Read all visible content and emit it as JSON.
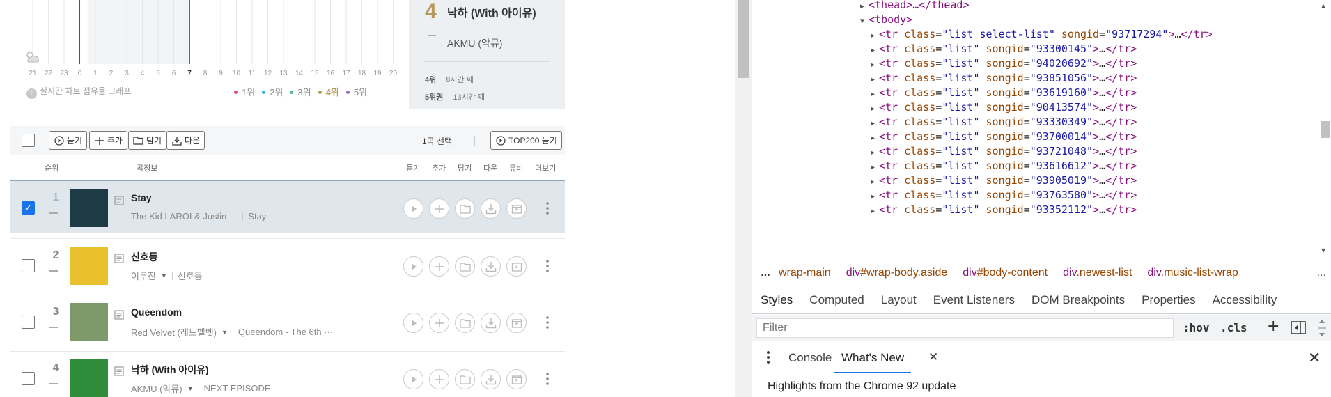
{
  "graph": {
    "hours": [
      "21",
      "22",
      "23",
      "0",
      "1",
      "2",
      "3",
      "4",
      "5",
      "6",
      "7",
      "8",
      "9",
      "10",
      "11",
      "12",
      "13",
      "14",
      "15",
      "16",
      "17",
      "18",
      "19",
      "20"
    ],
    "current_hour_index": 10,
    "help_text": "실시간 차트 점유율 그래프",
    "legend": [
      {
        "label": "1위",
        "color": "#e94b6b",
        "active": false
      },
      {
        "label": "2위",
        "color": "#2db3d9",
        "active": false
      },
      {
        "label": "3위",
        "color": "#4dbb8c",
        "active": false
      },
      {
        "label": "4위",
        "color": "#b8975a",
        "active": true
      },
      {
        "label": "5위",
        "color": "#8b6fc9",
        "active": false
      }
    ]
  },
  "rank_panel": {
    "rank": "4",
    "song": "낙하 (With 아이유)",
    "artist": "AKMU (악뮤)",
    "stat1_label": "4위",
    "stat1_value": "8시간 째",
    "stat2_label": "5위권",
    "stat2_value": "13시간 째"
  },
  "toolbar": {
    "play": "듣기",
    "add": "추가",
    "save": "담기",
    "download": "다운",
    "selected": "1곡 선택",
    "top200": "TOP200 듣기"
  },
  "table_header": {
    "rank": "순위",
    "info": "곡정보",
    "play": "듣기",
    "add": "추가",
    "save": "담기",
    "download": "다운",
    "mv": "뮤비",
    "more": "더보기"
  },
  "songs": [
    {
      "rank": "1",
      "title": "Stay",
      "artist": "The Kid LAROI & Justin",
      "artist_more": "···",
      "album": "Stay",
      "checked": true,
      "art": "#1d3a45"
    },
    {
      "rank": "2",
      "title": "신호등",
      "artist": "이무진",
      "artist_more": "▼",
      "album": "신호등",
      "checked": false,
      "art": "#e8c12c"
    },
    {
      "rank": "3",
      "title": "Queendom",
      "artist": "Red Velvet (레드벨벳)",
      "artist_more": "▼",
      "album": "Queendom - The 6th ···",
      "checked": false,
      "art": "#7e9a6a"
    },
    {
      "rank": "4",
      "title": "낙하 (With 아이유)",
      "artist": "AKMU (악뮤)",
      "artist_more": "▼",
      "album": "NEXT EPISODE",
      "checked": false,
      "art": "#2f8c3a"
    }
  ],
  "devtools": {
    "dom_lines": [
      {
        "indent": 1,
        "tri": "▶",
        "text": "<thead>…</thead>",
        "kind": "plain-tag"
      },
      {
        "indent": 1,
        "tri": "▼",
        "text": "<tbody>",
        "kind": "plain-tag"
      },
      {
        "indent": 2,
        "tri": "▶",
        "cls": "list select-list",
        "songid": "93717294"
      },
      {
        "indent": 2,
        "tri": "▶",
        "cls": "list",
        "songid": "93300145"
      },
      {
        "indent": 2,
        "tri": "▶",
        "cls": "list",
        "songid": "94020692"
      },
      {
        "indent": 2,
        "tri": "▶",
        "cls": "list",
        "songid": "93851056"
      },
      {
        "indent": 2,
        "tri": "▶",
        "cls": "list",
        "songid": "93619160"
      },
      {
        "indent": 2,
        "tri": "▶",
        "cls": "list",
        "songid": "90413574"
      },
      {
        "indent": 2,
        "tri": "▶",
        "cls": "list",
        "songid": "93330349"
      },
      {
        "indent": 2,
        "tri": "▶",
        "cls": "list",
        "songid": "93700014"
      },
      {
        "indent": 2,
        "tri": "▶",
        "cls": "list",
        "songid": "93721048"
      },
      {
        "indent": 2,
        "tri": "▶",
        "cls": "list",
        "songid": "93616612"
      },
      {
        "indent": 2,
        "tri": "▶",
        "cls": "list",
        "songid": "93905019"
      },
      {
        "indent": 2,
        "tri": "▶",
        "cls": "list",
        "songid": "93763580"
      },
      {
        "indent": 2,
        "tri": "▶",
        "cls": "list",
        "songid": "93352112"
      }
    ],
    "breadcrumbs": [
      {
        "tag": "",
        "id": "wrap-main"
      },
      {
        "tag": "div",
        "id": "#wrap-body.aside"
      },
      {
        "tag": "div",
        "id": "#body-content"
      },
      {
        "tag": "div",
        "id": ".newest-list"
      },
      {
        "tag": "div",
        "id": ".music-list-wrap"
      }
    ],
    "crumb_more": "...",
    "crumb_end": "...",
    "subtabs": [
      "Styles",
      "Computed",
      "Layout",
      "Event Listeners",
      "DOM Breakpoints",
      "Properties",
      "Accessibility"
    ],
    "active_subtab": "Styles",
    "filter_placeholder": "Filter",
    "hov": ":hov",
    "cls": ".cls",
    "drawer_tabs": [
      "Console",
      "What's New"
    ],
    "active_drawer_tab": "What's New",
    "whats_new_text": "Highlights from the Chrome 92 update"
  }
}
